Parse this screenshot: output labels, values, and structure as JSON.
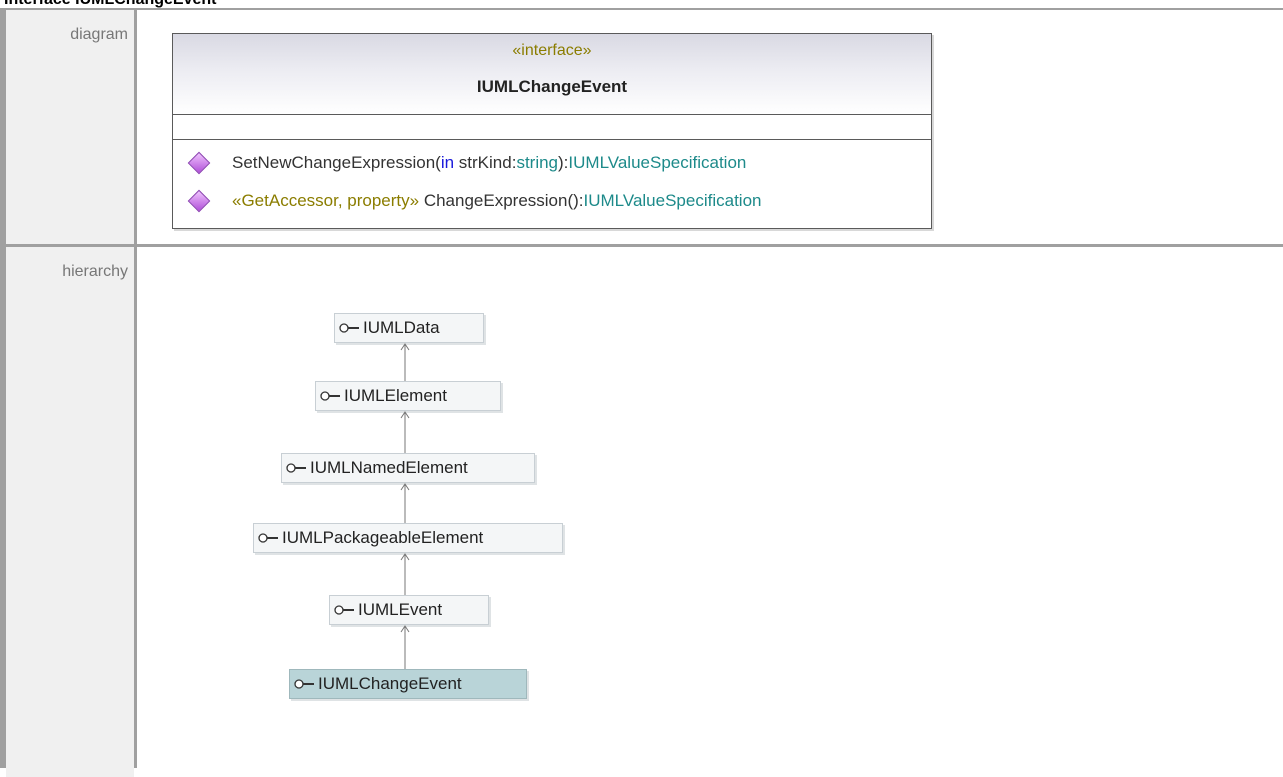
{
  "page_title": "Interface IUMLChangeEvent",
  "rows": {
    "diagram_label": "diagram",
    "hierarchy_label": "hierarchy"
  },
  "uml_class": {
    "stereotype": "«interface»",
    "name": "IUMLChangeEvent",
    "operations": [
      {
        "name": "SetNewChangeExpression(",
        "param_direction": "in",
        "param_name": " strKind:",
        "param_type": "string",
        "close": "):",
        "return_type": "IUMLValueSpecification"
      },
      {
        "stereotype": "«GetAccessor, property»",
        "name": " ChangeExpression():",
        "return_type": "IUMLValueSpecification"
      }
    ]
  },
  "hierarchy": [
    {
      "label": "IUMLData",
      "current": false
    },
    {
      "label": "IUMLElement",
      "current": false
    },
    {
      "label": "IUMLNamedElement",
      "current": false
    },
    {
      "label": "IUMLPackageableElement",
      "current": false
    },
    {
      "label": "IUMLEvent",
      "current": false
    },
    {
      "label": "IUMLChangeEvent",
      "current": true
    }
  ],
  "colors": {
    "stereotype": "#8b7d00",
    "keyword": "#1a1adb",
    "type": "#1d8a8a",
    "current_node": "#b9d4d8"
  },
  "icons": {
    "operation": "public-operation-diamond-icon",
    "interface": "interface-lollipop-icon",
    "generalization": "generalization-arrow-icon"
  }
}
